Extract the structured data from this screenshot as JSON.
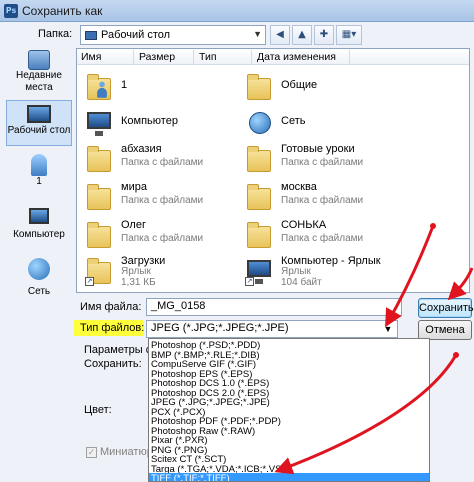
{
  "window": {
    "title": "Сохранить как",
    "app_icon": "Ps"
  },
  "toolbar": {
    "folder_label": "Папка:",
    "folder_value": "Рабочий стол",
    "back_icon": "back-icon",
    "up_icon": "up-folder-icon",
    "new_folder_icon": "new-folder-icon",
    "views_icon": "views-menu-icon"
  },
  "places": [
    {
      "label": "Недавние места",
      "icon": "recent-places-icon"
    },
    {
      "label": "Рабочий стол",
      "icon": "desktop-icon",
      "active": true
    },
    {
      "label": "1",
      "icon": "user-icon"
    },
    {
      "label": "Компьютер",
      "icon": "computer-icon"
    },
    {
      "label": "Сеть",
      "icon": "network-icon"
    }
  ],
  "columns": [
    "Имя",
    "Размер",
    "Тип",
    "Дата изменения"
  ],
  "items": [
    {
      "name": "1",
      "sub": "",
      "icon": "user-folder-icon"
    },
    {
      "name": "Общие",
      "sub": "",
      "icon": "folder-icon"
    },
    {
      "name": "Компьютер",
      "sub": "",
      "icon": "computer-icon"
    },
    {
      "name": "Сеть",
      "sub": "",
      "icon": "network-icon"
    },
    {
      "name": "абхазия",
      "sub": "Папка с файлами",
      "icon": "folder-icon"
    },
    {
      "name": "Готовые уроки",
      "sub": "Папка с файлами",
      "icon": "folder-icon"
    },
    {
      "name": "мира",
      "sub": "Папка с файлами",
      "icon": "folder-icon"
    },
    {
      "name": "москва",
      "sub": "Папка с файлами",
      "icon": "folder-icon"
    },
    {
      "name": "Олег",
      "sub": "Папка с файлами",
      "icon": "folder-icon"
    },
    {
      "name": "СОНЬКА",
      "sub": "Папка с файлами",
      "icon": "folder-icon"
    },
    {
      "name": "Загрузки",
      "sub": "Ярлык",
      "sub2": "1,31 КБ",
      "icon": "downloads-shortcut-icon"
    },
    {
      "name": "Компьютер - Ярлык",
      "sub": "Ярлык",
      "sub2": "104 байт",
      "icon": "computer-shortcut-icon"
    }
  ],
  "form": {
    "filename_label": "Имя файла:",
    "filename_value": "_MG_0158",
    "filetype_label": "Тип файлов:",
    "filetype_value": "JPEG (*.JPG;*.JPEG;*.JPE)",
    "save_button": "Сохранить",
    "cancel_button": "Отмена",
    "params_label": "Параметры сох",
    "save_label": "Сохранить:",
    "color_label": "Цвет:",
    "thumbnail_label": "Миниатюра"
  },
  "filetype_options": [
    "Photoshop (*.PSD;*.PDD)",
    "BMP (*.BMP;*.RLE;*.DIB)",
    "CompuServe GIF (*.GIF)",
    "Photoshop EPS (*.EPS)",
    "Photoshop DCS 1.0 (*.EPS)",
    "Photoshop DCS 2.0 (*.EPS)",
    "JPEG (*.JPG;*.JPEG;*.JPE)",
    "PCX (*.PCX)",
    "Photoshop PDF (*.PDF;*.PDP)",
    "Photoshop Raw (*.RAW)",
    "Pixar (*.PXR)",
    "PNG (*.PNG)",
    "Scitex CT (*.SCT)",
    "Targa (*.TGA;*.VDA;*.ICB;*.VST)",
    "TIFF (*.TIF;*.TIFF)"
  ],
  "selected_option_index": 14,
  "colors": {
    "accent": "#3399ff",
    "highlight": "#ffff3c",
    "annotation_arrow": "#e0141e"
  }
}
